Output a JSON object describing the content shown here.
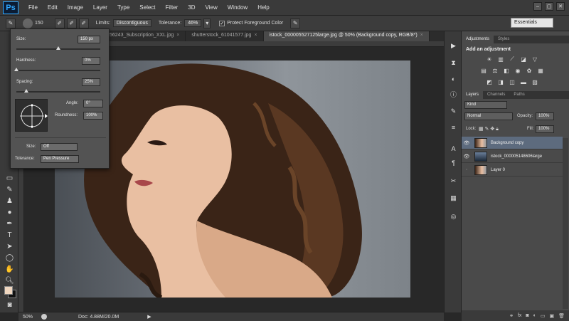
{
  "app": {
    "logo": "Ps"
  },
  "menu": [
    "File",
    "Edit",
    "Image",
    "Layer",
    "Type",
    "Select",
    "Filter",
    "3D",
    "View",
    "Window",
    "Help"
  ],
  "window_controls": [
    "–",
    "▢",
    "✕"
  ],
  "options_bar": {
    "brush_size": "150",
    "limits_label": "Limits:",
    "limits_value": "Discontiguous",
    "tolerance_label": "Tolerance:",
    "tolerance_value": "46%",
    "protect_label": "Protect Foreground Color",
    "workspace": "Essentials"
  },
  "doc_tabs": [
    {
      "label": "56243_Subscription_XXL.jpg",
      "active": false
    },
    {
      "label": "shutterstock_61041577.jpg",
      "active": false
    },
    {
      "label": "istock_000005527125large.jpg @ 50% (Background copy, RGB/8*)",
      "active": true
    }
  ],
  "brush_popup": {
    "size_label": "Size:",
    "size_value": "150 px",
    "size_level": 0.5,
    "hardness_label": "Hardness:",
    "hardness_value": "0%",
    "hardness_level": 0.0,
    "spacing_label": "Spacing:",
    "spacing_value": "25%",
    "spacing_level": 0.12,
    "angle_label": "Angle:",
    "angle_value": "0°",
    "roundness_label": "Roundness:",
    "roundness_value": "100%",
    "size_ctrl_label": "Size:",
    "size_ctrl_value": "Off",
    "tolerance_label": "Tolerance:",
    "tolerance_value": "Pen Pressure"
  },
  "status": {
    "zoom": "50%",
    "doc": "Doc: 4.88M/20.0M"
  },
  "adjustments": {
    "tabs": [
      "Adjustments",
      "Styles"
    ],
    "title": "Add an adjustment"
  },
  "layers_panel": {
    "tabs": [
      "Layers",
      "Channels",
      "Paths"
    ],
    "kind": "Kind",
    "blend_mode": "Normal",
    "opacity_label": "Opacity:",
    "opacity_value": "100%",
    "lock_label": "Lock:",
    "fill_label": "Fill:",
    "fill_value": "100%",
    "layers": [
      {
        "name": "Background copy",
        "visible": true,
        "selected": true
      },
      {
        "name": "istock_000005148606large",
        "visible": true,
        "selected": false
      },
      {
        "name": "Layer 0",
        "visible": false,
        "selected": false
      }
    ]
  },
  "colors": {
    "foreground": "#f0d7c0",
    "background": "#111111",
    "selection": "#5d6b7e"
  }
}
